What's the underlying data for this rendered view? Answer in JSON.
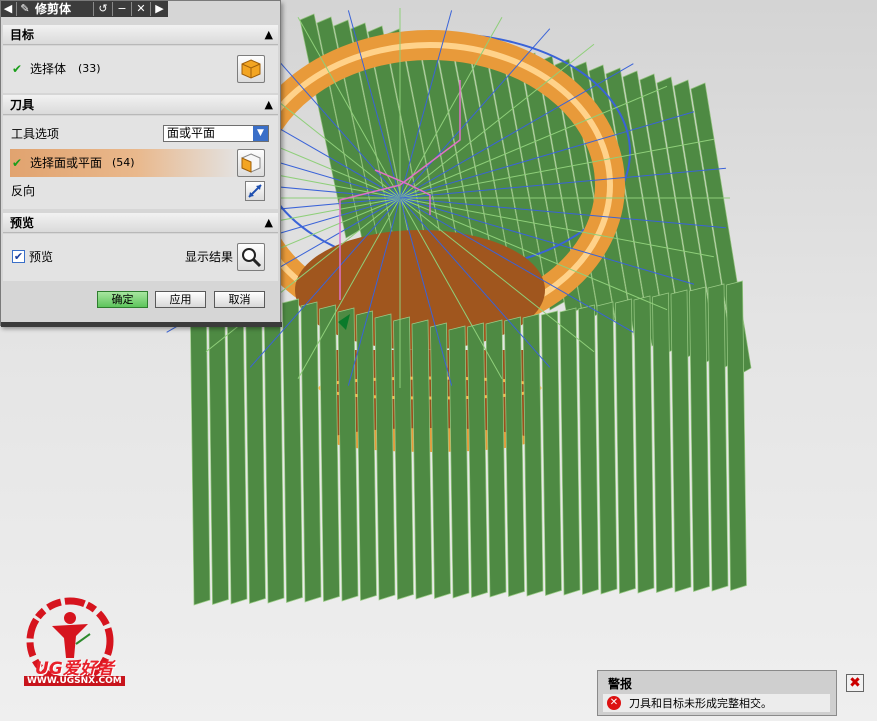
{
  "dialog": {
    "title": "修剪体",
    "sections": {
      "target": {
        "header": "目标",
        "select_label": "选择体",
        "select_count": "(33)"
      },
      "tool": {
        "header": "刀具",
        "option_label": "工具选项",
        "option_value": "面或平面",
        "select_label": "选择面或平面",
        "select_count": "(54)",
        "reverse_label": "反向"
      },
      "preview": {
        "header": "预览",
        "checkbox_label": "预览",
        "checked": true,
        "show_result_label": "显示结果"
      }
    },
    "buttons": {
      "ok": "确定",
      "apply": "应用",
      "cancel": "取消"
    }
  },
  "warning": {
    "title": "警报",
    "message": "刀具和目标未形成完整相交。"
  },
  "logo": {
    "brand": "UG爱好者",
    "url": "WWW.UGSNX.COM"
  },
  "colors": {
    "fin_green": "#4e8a43",
    "ring_orange": "#e89a3a",
    "ring_blue": "#3a63d8",
    "highlight_orange": "#e1a36f"
  }
}
